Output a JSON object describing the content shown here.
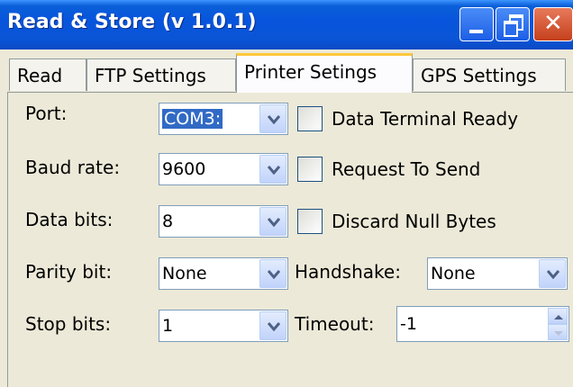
{
  "window": {
    "title": "Read & Store (v 1.0.1)"
  },
  "tabs": [
    {
      "label": "Read",
      "active": false
    },
    {
      "label": "FTP Settings",
      "active": false
    },
    {
      "label": "Printer Setings",
      "active": true
    },
    {
      "label": "GPS Settings",
      "active": false
    }
  ],
  "form": {
    "port": {
      "label": "Port:",
      "value": "COM3:"
    },
    "baud_rate": {
      "label": "Baud rate:",
      "value": "9600"
    },
    "data_bits": {
      "label": "Data bits:",
      "value": "8"
    },
    "parity_bit": {
      "label": "Parity bit:",
      "value": "None"
    },
    "stop_bits": {
      "label": "Stop bits:",
      "value": "1"
    },
    "handshake": {
      "label": "Handshake:",
      "value": "None"
    },
    "timeout": {
      "label": "Timeout:",
      "value": "-1"
    },
    "checkboxes": {
      "dtr": {
        "label": "Data Terminal Ready",
        "checked": false
      },
      "rts": {
        "label": "Request To Send",
        "checked": false
      },
      "discard_null": {
        "label": "Discard Null Bytes",
        "checked": false
      }
    }
  },
  "icons": {
    "minimize": "minimize-icon",
    "maximize": "maximize-icon",
    "close": "close-icon",
    "dropdown": "chevron-down-icon"
  },
  "colors": {
    "titlebar": "#0855dd",
    "window_bg": "#ece9d8",
    "selection": "#316ac5",
    "active_tab_accent": "#ffc83c"
  }
}
